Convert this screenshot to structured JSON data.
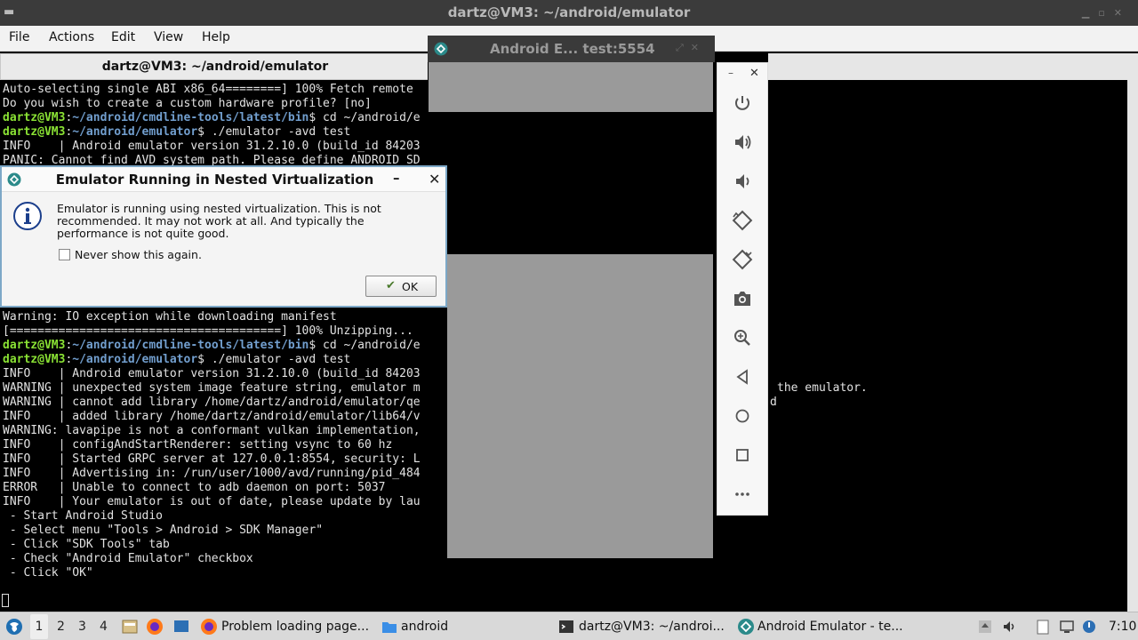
{
  "window": {
    "title": "dartz@VM3: ~/android/emulator"
  },
  "menu": {
    "items": [
      "File",
      "Actions",
      "Edit",
      "View",
      "Help"
    ]
  },
  "tab": {
    "title": "dartz@VM3: ~/android/emulator"
  },
  "terminal": {
    "prompt_user": "dartz@VM3",
    "lines": {
      "l1": "Auto-selecting single ABI x86_64========] 100% Fetch remote",
      "l2": "Do you wish to create a custom hardware profile? [no]",
      "l3_path": "~/android/cmdline-tools/latest/bin",
      "l3_cmd": "$ cd ~/android/e",
      "l4_path": "~/android/emulator",
      "l4_cmd": "$ ./emulator -avd test",
      "l5": "INFO    | Android emulator version 31.2.10.0 (build_id 84203",
      "l6": "PANIC: Cannot find AVD system path. Please define ANDROID SD",
      "l7": "Warning: IO exception while downloading manifest",
      "l8": "[=======================================] 100% Unzipping...",
      "l9_path": "~/android/cmdline-tools/latest/bin",
      "l9_cmd": "$ cd ~/android/e",
      "l10_path": "~/android/emulator",
      "l10_cmd": "$ ./emulator -avd test",
      "l11": "INFO    | Android emulator version 31.2.10.0 (build_id 84203",
      "l12": "WARNING | unexpected system image feature string, emulator m",
      "l13": "WARNING | cannot add library /home/dartz/android/emulator/qe",
      "l14": "INFO    | added library /home/dartz/android/emulator/lib64/v",
      "l15": "WARNING: lavapipe is not a conformant vulkan implementation,",
      "l16": "INFO    | configAndStartRenderer: setting vsync to 60 hz",
      "l17": "INFO    | Started GRPC server at 127.0.0.1:8554, security: L",
      "l18": "INFO    | Advertising in: /run/user/1000/avd/running/pid_484",
      "l19": "ERROR   | Unable to connect to adb daemon on port: 5037",
      "l20": "INFO    | Your emulator is out of date, please update by lau",
      "l21": " - Start Android Studio",
      "l22": " - Select menu \"Tools > Android > SDK Manager\"",
      "l23": " - Click \"SDK Tools\" tab",
      "l24": " - Check \"Android Emulator\" checkbox",
      "l25": " - Click \"OK\""
    },
    "right_fragment_1": "the emulator.",
    "right_fragment_2": "d"
  },
  "dialog": {
    "title": "Emulator Running in Nested Virtualization",
    "message": "Emulator is running using nested virtualization. This is not recommended. It may not work at all. And typically the performance is not quite good.",
    "checkbox_label": "Never show this again.",
    "checkbox_checked": false,
    "ok_label": "OK"
  },
  "emulator": {
    "title": "Android E... test:5554"
  },
  "toolbar": {
    "icons": [
      "power-icon",
      "volume-up-icon",
      "volume-down-icon",
      "rotate-left-icon",
      "rotate-right-icon",
      "camera-icon",
      "zoom-icon",
      "back-icon",
      "home-icon",
      "overview-icon",
      "more-icon"
    ]
  },
  "taskbar": {
    "workspaces": [
      "1",
      "2",
      "3",
      "4"
    ],
    "active_workspace": "1",
    "tasks": {
      "firefox": "Problem loading page...",
      "files": "android",
      "terminal": "dartz@VM3: ~/androi...",
      "emulator": "Android Emulator - te..."
    },
    "clock": "7:10"
  },
  "colors": {
    "prompt_green": "#8ae234",
    "path_blue": "#729fcf",
    "emulator_accent": "#2b8a8a"
  }
}
